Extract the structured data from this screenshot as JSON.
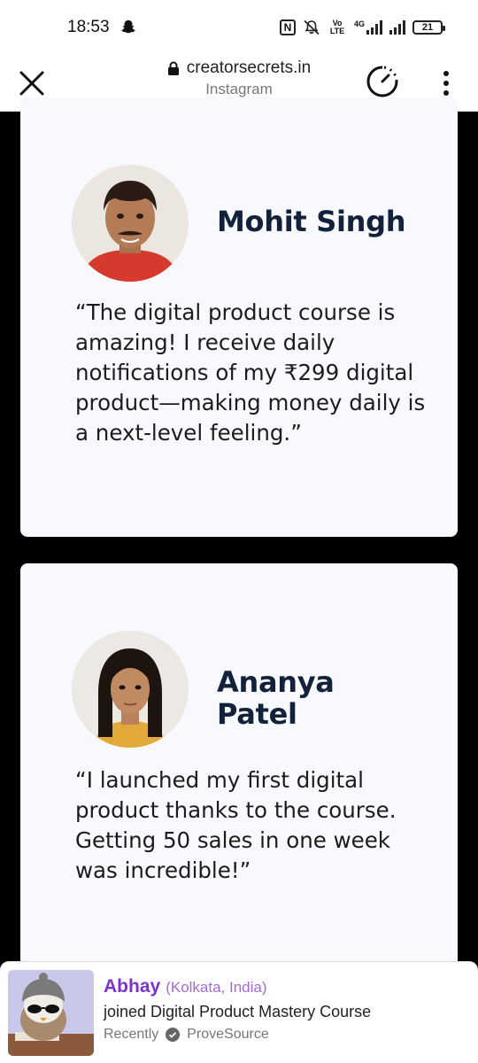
{
  "status_bar": {
    "time": "18:53",
    "network_label": "4G",
    "volte_label": "Vo LTE",
    "battery": "21",
    "icons": [
      "snapchat-icon",
      "nfc-icon",
      "mute-icon",
      "signal-icon",
      "battery-icon"
    ]
  },
  "browser": {
    "url": "creatorsecrets.in",
    "source": "Instagram",
    "icons": [
      "close-icon",
      "lock-icon",
      "timer-icon",
      "more-vert-icon"
    ]
  },
  "testimonials": [
    {
      "name": "Mohit Singh",
      "quote": "“The digital product course is amazing! I receive daily notifications of my ₹299 digital product—making money daily is a next-level feeling.”"
    },
    {
      "name": "Ananya Patel",
      "quote": "“I launched my first digital product thanks to the course. Getting 50 sales in one week was incredible!”"
    }
  ],
  "notification": {
    "user": "Abhay",
    "location": "(Kolkata, India)",
    "action": "joined Digital Product Mastery Course",
    "time": "Recently",
    "provider": "ProveSource"
  },
  "colors": {
    "card_bg": "#f7f9fd",
    "name_text": "#13223a",
    "notification_user": "#7b34c9",
    "notification_location": "#a56ad8"
  }
}
